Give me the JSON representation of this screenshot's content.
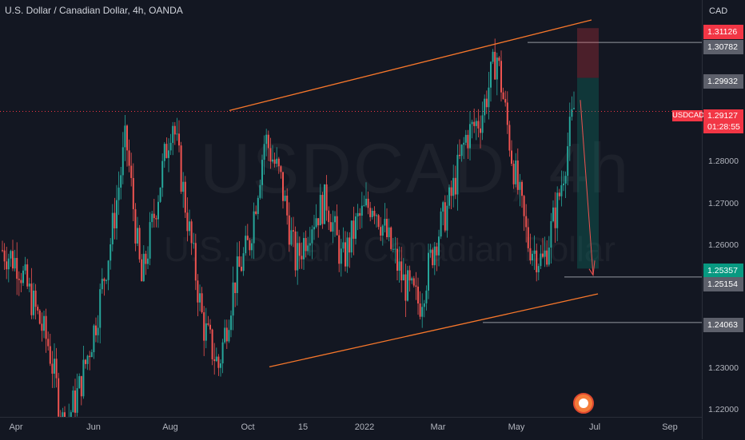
{
  "header": {
    "title": "U.S. Dollar / Canadian Dollar, 4h, OANDA"
  },
  "watermark": {
    "symbol_tf": "USDCAD, 4h",
    "name": "U.S. Dollar / Canadian Dollar"
  },
  "price_axis": {
    "currency": "CAD",
    "ticks": [
      "1.28000",
      "1.27000",
      "1.26000",
      "1.23000",
      "1.22000"
    ]
  },
  "price_labels": {
    "target": "1.31126",
    "stop_line": "1.30782",
    "entry": "1.29932",
    "current": "1.29127",
    "countdown": "01:28:55",
    "ticker": "USDCAD",
    "tp_zone": "1.25357",
    "tp_line": "1.25154",
    "support": "1.24063"
  },
  "time_axis": [
    "Apr",
    "Jun",
    "Aug",
    "Oct",
    "15",
    "2022",
    "Mar",
    "May",
    "Jul",
    "Sep"
  ],
  "colors": {
    "up": "#26a69a",
    "down": "#ef5350",
    "channel": "#f7772b",
    "current": "#f23645",
    "background": "#131722"
  },
  "chart_data": {
    "type": "candlestick",
    "symbol": "USDCAD",
    "timeframe": "4h",
    "ylim": [
      1.218,
      1.318
    ],
    "x": [
      "2021-03",
      "2021-04",
      "2021-05",
      "2021-06",
      "2021-07",
      "2021-08",
      "2021-09",
      "2021-10",
      "2021-11",
      "2021-12",
      "2022-01",
      "2022-02",
      "2022-03",
      "2022-04",
      "2022-05",
      "2022-06"
    ],
    "close_path": [
      1.258,
      1.255,
      1.245,
      1.235,
      1.215,
      1.225,
      1.24,
      1.26,
      1.285,
      1.25,
      1.27,
      1.29,
      1.265,
      1.24,
      1.23,
      1.25,
      1.26,
      1.285,
      1.275,
      1.255,
      1.265,
      1.27,
      1.255,
      1.265,
      1.27,
      1.26,
      1.25,
      1.245,
      1.26,
      1.27,
      1.285,
      1.29,
      1.305,
      1.28,
      1.26,
      1.255,
      1.27,
      1.292
    ],
    "current_price": 1.29127,
    "levels": [
      1.31126,
      1.30782,
      1.29932,
      1.25357,
      1.25154,
      1.24063
    ]
  }
}
